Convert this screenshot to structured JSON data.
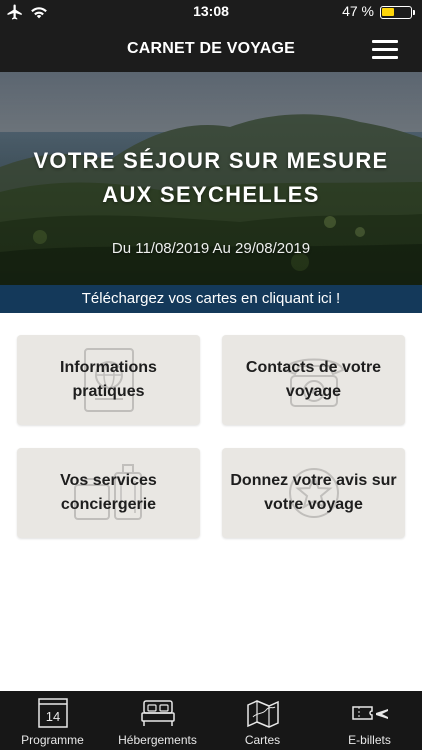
{
  "status_bar": {
    "time": "13:08",
    "battery_text": "47 %",
    "battery_level": 0.47,
    "icons": [
      "airplane-icon",
      "wifi-icon",
      "battery-icon"
    ]
  },
  "nav": {
    "title": "CARNET DE VOYAGE",
    "menu_icon": "hamburger-menu-icon"
  },
  "hero": {
    "headline_line1": "VOTRE SÉJOUR SUR MESURE",
    "headline_line2": "AUX SEYCHELLES",
    "dates": "Du 11/08/2019 Au 29/08/2019"
  },
  "download_banner": "Téléchargez vos cartes en cliquant ici !",
  "cards": [
    {
      "line1": "Informations",
      "line2": "pratiques",
      "icon": "passport-icon"
    },
    {
      "line1": "Contacts de votre",
      "line2": "voyage",
      "icon": "telephone-icon"
    },
    {
      "line1": "Vos services",
      "line2": "conciergerie",
      "icon": "luggage-icon"
    },
    {
      "line1": "Donnez votre avis sur",
      "line2": "votre voyage",
      "icon": "review-star-icon"
    }
  ],
  "tabs": [
    {
      "label": "Programme",
      "icon": "calendar-icon",
      "icon_text": "14"
    },
    {
      "label": "Hébergements",
      "icon": "bed-icon"
    },
    {
      "label": "Cartes",
      "icon": "map-icon"
    },
    {
      "label": "E-billets",
      "icon": "ticket-plane-icon"
    }
  ],
  "colors": {
    "top_bar": "#1c1c1c",
    "banner": "#14395a",
    "card": "#e9e7e3",
    "tab_bar": "#171717",
    "battery": "#ffd60a"
  }
}
